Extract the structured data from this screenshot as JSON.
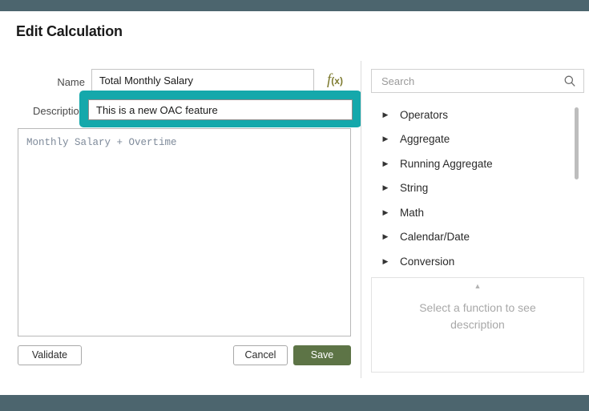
{
  "window": {
    "top_bar_color": "#4c656e",
    "bottom_bar_color": "#4c656e"
  },
  "dialog": {
    "title": "Edit Calculation"
  },
  "form": {
    "name_label": "Name",
    "name_value": "Total Monthly Salary",
    "name_placeholder": "",
    "description_label": "Description",
    "description_value": "This is a new OAC feature",
    "description_placeholder": "",
    "description_focused": true,
    "focus_ring_color": "#15a8ab",
    "fx_icon_main": "f",
    "fx_icon_sub": "(x)",
    "fx_icon_color": "#7d7a2e"
  },
  "editor": {
    "formula": "Monthly Salary + Overtime",
    "text_color": "#7e8a9a"
  },
  "actions": {
    "validate_label": "Validate",
    "cancel_label": "Cancel",
    "save_label": "Save",
    "save_color": "#5d7446"
  },
  "function_panel": {
    "search_placeholder": "Search",
    "search_value": "",
    "categories": [
      {
        "label": "Operators"
      },
      {
        "label": "Aggregate"
      },
      {
        "label": "Running Aggregate"
      },
      {
        "label": "String"
      },
      {
        "label": "Math"
      },
      {
        "label": "Calendar/Date"
      },
      {
        "label": "Conversion"
      }
    ],
    "description_panel": {
      "placeholder_text": "Select a function to see description"
    }
  }
}
